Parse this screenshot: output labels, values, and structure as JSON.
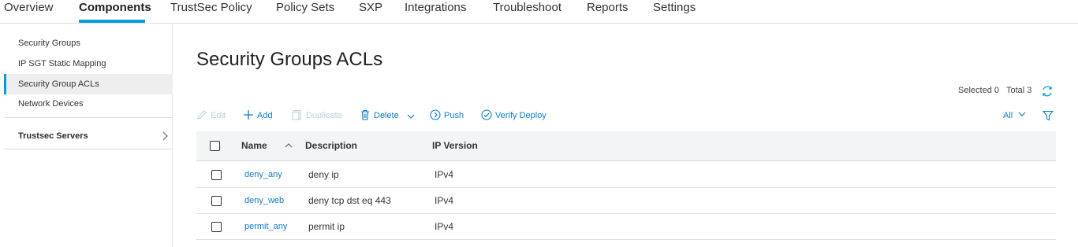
{
  "nav": {
    "tabs": [
      {
        "label": "Overview"
      },
      {
        "label": "Components"
      },
      {
        "label": "TrustSec Policy"
      },
      {
        "label": "Policy Sets"
      },
      {
        "label": "SXP"
      },
      {
        "label": "Integrations"
      },
      {
        "label": "Troubleshoot"
      },
      {
        "label": "Reports"
      },
      {
        "label": "Settings"
      }
    ],
    "active_tab": "Components"
  },
  "sidebar": {
    "items": [
      {
        "label": "Security Groups"
      },
      {
        "label": "IP SGT Static Mapping"
      },
      {
        "label": "Security Group ACLs"
      },
      {
        "label": "Network Devices"
      }
    ],
    "active_item": "Security Group ACLs",
    "group": {
      "label": "Trustsec Servers"
    }
  },
  "main": {
    "title": "Security Groups ACLs",
    "selection": {
      "selected_label": "Selected",
      "selected_count": "0",
      "total_label": "Total",
      "total_count": "3"
    },
    "toolbar": {
      "edit": "Edit",
      "add": "Add",
      "duplicate": "Duplicate",
      "delete": "Delete",
      "push": "Push",
      "verify_deploy": "Verify Deploy",
      "filter_value": "All"
    },
    "table": {
      "columns": {
        "name": "Name",
        "description": "Description",
        "ip_version": "IP Version"
      },
      "rows": [
        {
          "name": "deny_any",
          "description": "deny ip",
          "ip_version": "IPv4"
        },
        {
          "name": "deny_web",
          "description": "deny tcp dst eq 443",
          "ip_version": "IPv4"
        },
        {
          "name": "permit_any",
          "description": "permit ip",
          "ip_version": "IPv4"
        }
      ]
    }
  },
  "colors": {
    "accent": "#049fd9",
    "link": "#0d7cc7",
    "disabled": "#b9cfe0",
    "header_bg": "#f2f4f5"
  }
}
